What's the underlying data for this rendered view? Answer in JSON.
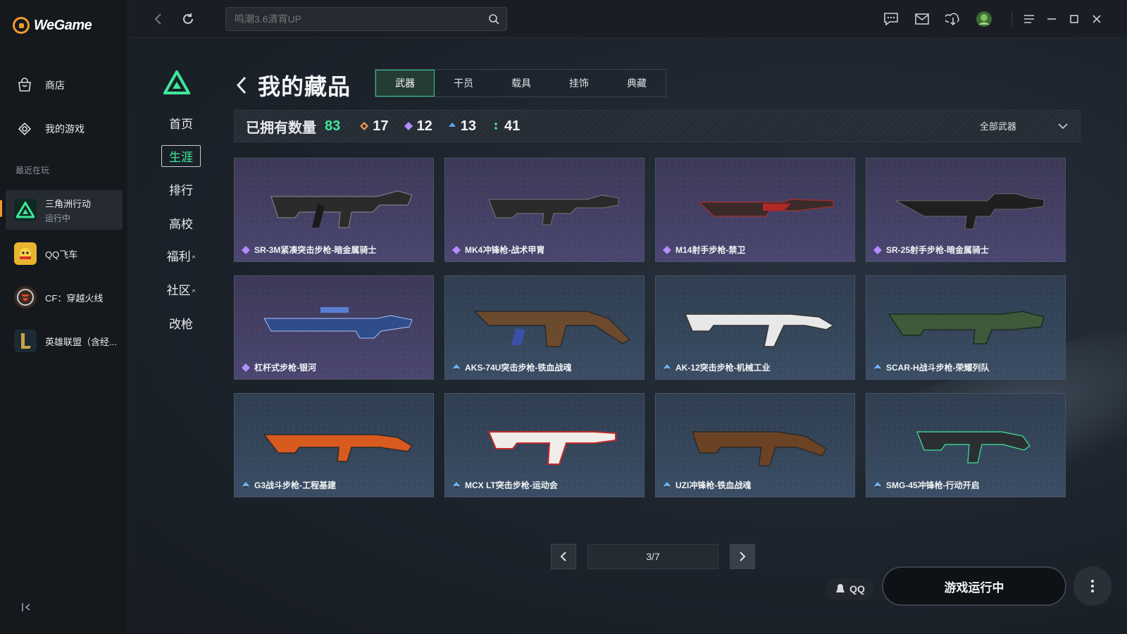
{
  "brand": {
    "name": "WeGame"
  },
  "sidebar": {
    "nav": [
      {
        "label": "商店",
        "icon": "store-bag-icon"
      },
      {
        "label": "我的游戏",
        "icon": "my-games-icon"
      }
    ],
    "recent_label": "最近在玩",
    "games": [
      {
        "name": "三角洲行动",
        "status": "运行中",
        "icon": "delta-force-icon",
        "active": true
      },
      {
        "name": "QQ飞车",
        "status": "",
        "icon": "qq-speed-icon",
        "active": false
      },
      {
        "name": "CF：穿越火线",
        "status": "",
        "icon": "crossfire-icon",
        "active": false
      },
      {
        "name": "英雄联盟（含经...",
        "status": "",
        "icon": "league-icon",
        "active": false
      }
    ]
  },
  "topbar": {
    "search_placeholder": "鸣潮3.6清宵UP",
    "icons": [
      "back-icon",
      "refresh-icon",
      "chat-icon",
      "mail-icon",
      "download-icon",
      "avatar-icon",
      "menu-icon",
      "minimize-icon",
      "maximize-icon",
      "close-icon"
    ]
  },
  "game_nav": {
    "items": [
      {
        "label": "首页"
      },
      {
        "label": "生涯",
        "active": true
      },
      {
        "label": "排行"
      },
      {
        "label": "高校"
      },
      {
        "label": "福利",
        "caret": "^"
      },
      {
        "label": "社区",
        "caret": "^"
      },
      {
        "label": "改枪"
      }
    ]
  },
  "page": {
    "title": "我的藏品",
    "tabs": [
      {
        "label": "武器",
        "active": true
      },
      {
        "label": "干员"
      },
      {
        "label": "载具"
      },
      {
        "label": "挂饰"
      },
      {
        "label": "典藏"
      }
    ]
  },
  "stats": {
    "owned_label": "已拥有数量",
    "owned_total": "83",
    "rarity_counts": [
      {
        "value": "17",
        "color": "#f29a4a"
      },
      {
        "value": "12",
        "color": "#b48cff"
      },
      {
        "value": "13",
        "color": "#5aa8ff"
      },
      {
        "value": "41",
        "color": "#3ee89b"
      }
    ],
    "filter_label": "全部武器"
  },
  "cards": [
    {
      "label": "SR-3M紧凑突击步枪-暗金属骑士",
      "rarity": "purple",
      "accent": "#b7a7ff"
    },
    {
      "label": "MK4冲锋枪-战术甲胄",
      "rarity": "purple",
      "accent": "#b7a7ff"
    },
    {
      "label": "M14射手步枪-禁卫",
      "rarity": "purple",
      "accent": "#b7a7ff"
    },
    {
      "label": "SR-25射手步枪-暗金属骑士",
      "rarity": "purple",
      "accent": "#b7a7ff"
    },
    {
      "label": "杠杆式步枪-银河",
      "rarity": "purple",
      "accent": "#b7a7ff"
    },
    {
      "label": "AKS-74U突击步枪-铁血战魂",
      "rarity": "blue",
      "accent": "#6fb6ff"
    },
    {
      "label": "AK-12突击步枪-机械工业",
      "rarity": "blue",
      "accent": "#6fb6ff"
    },
    {
      "label": "SCAR-H战斗步枪-荣耀列队",
      "rarity": "blue",
      "accent": "#6fb6ff"
    },
    {
      "label": "G3战斗步枪-工程基建",
      "rarity": "blue",
      "accent": "#6fb6ff"
    },
    {
      "label": "MCX LT突击步枪-运动会",
      "rarity": "blue",
      "accent": "#6fb6ff"
    },
    {
      "label": "UZI冲锋枪-铁血战魂",
      "rarity": "blue",
      "accent": "#6fb6ff"
    },
    {
      "label": "SMG-45冲锋枪-行动开启",
      "rarity": "blue",
      "accent": "#6fb6ff"
    }
  ],
  "pager": {
    "page_text": "3/7"
  },
  "footer": {
    "qq_label": "QQ",
    "run_label": "游戏运行中"
  }
}
